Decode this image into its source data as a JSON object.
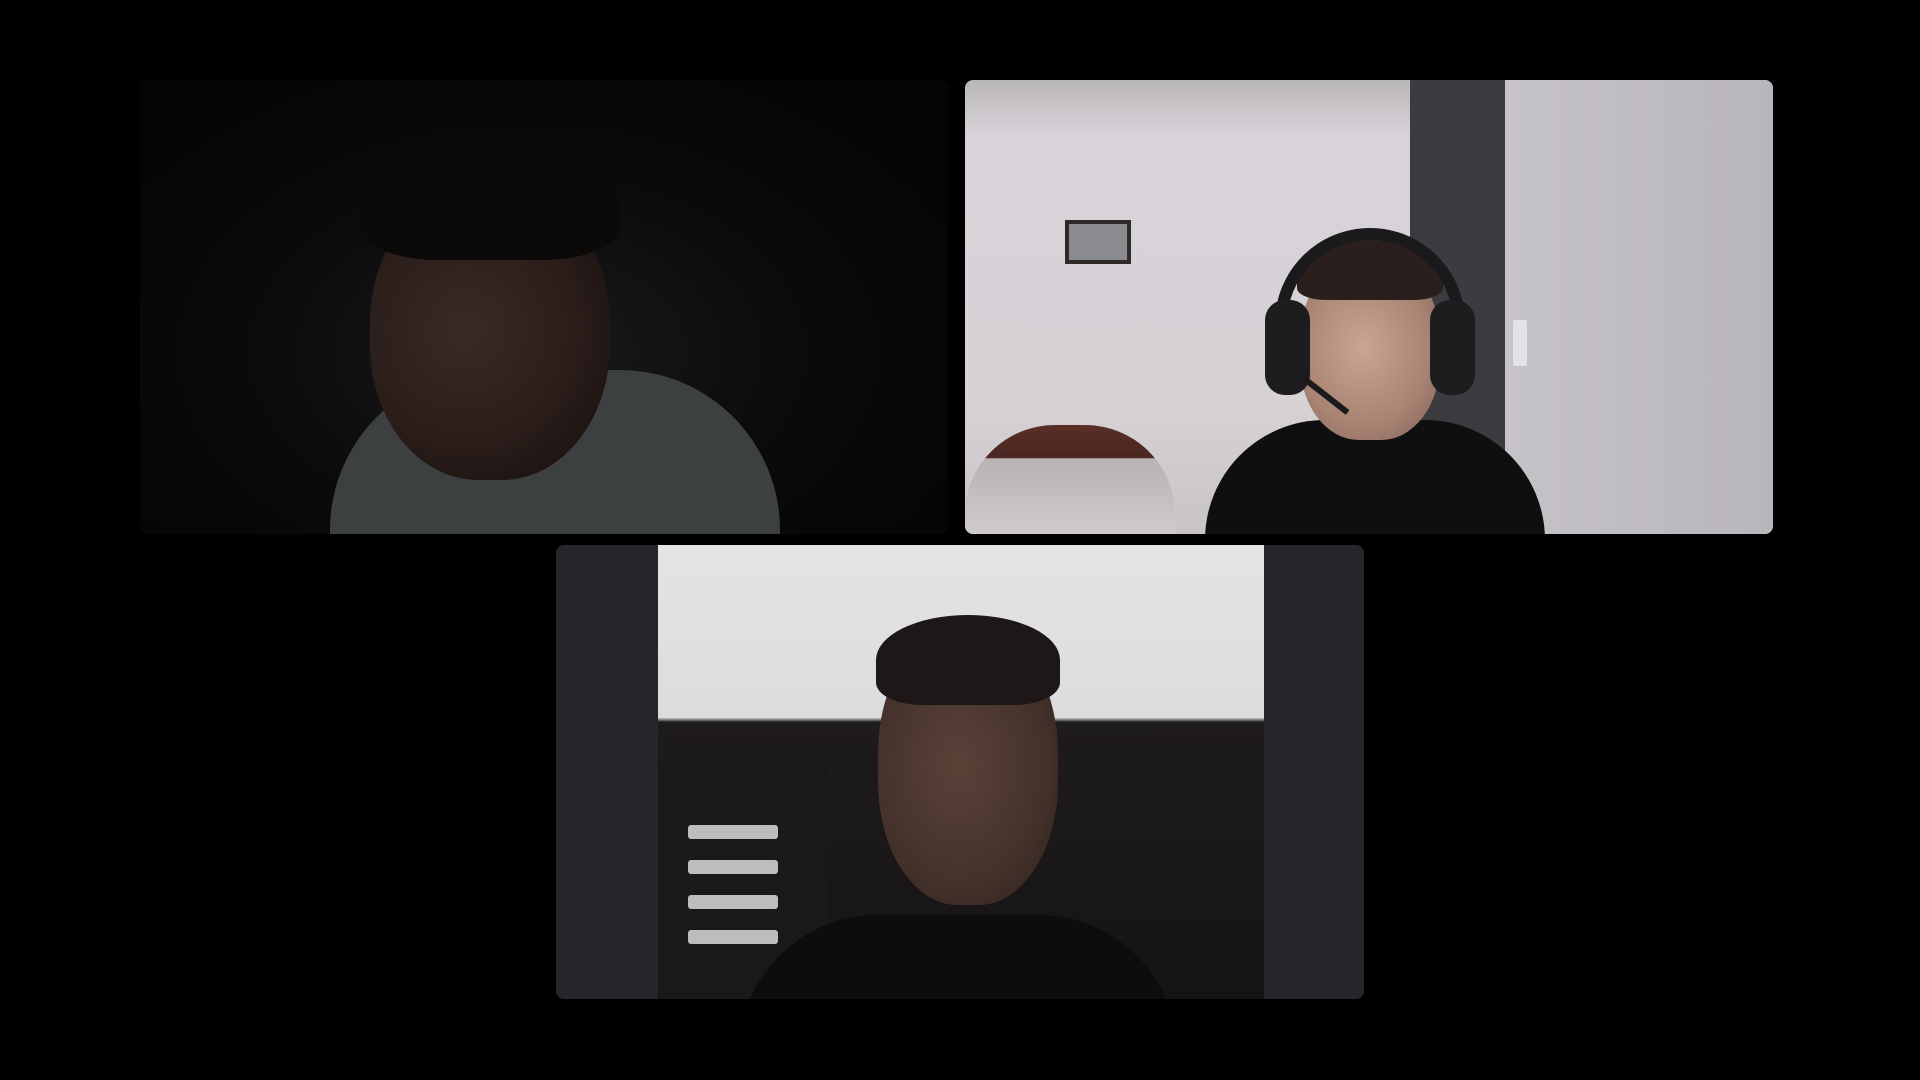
{
  "meeting": {
    "layout": "three-participant-grid",
    "background_color": "#000000",
    "participants": [
      {
        "id": "participant-1",
        "scene": "dark-room"
      },
      {
        "id": "participant-2",
        "scene": "lit-room-headset"
      },
      {
        "id": "participant-3",
        "scene": "white-wall-letterboxed"
      }
    ]
  }
}
